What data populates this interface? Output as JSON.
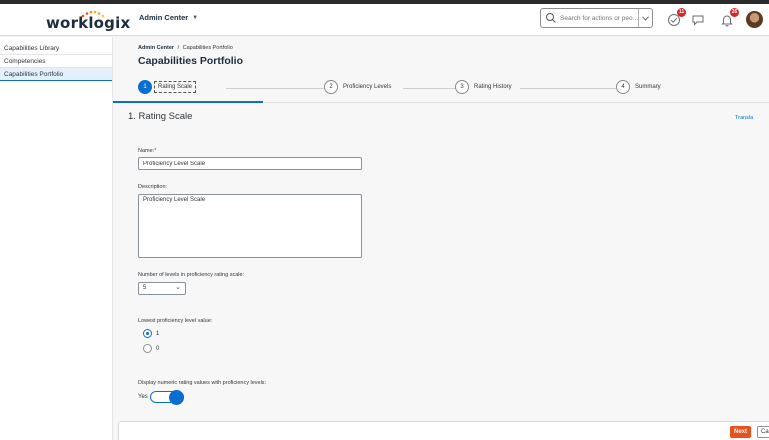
{
  "header": {
    "logo_text": "worklogix",
    "app_name": "Admin Center",
    "search_placeholder": "Search for actions or peo...",
    "badges": {
      "tasks": "11",
      "notifications": "26"
    }
  },
  "sidebar": {
    "items": [
      {
        "label": "Capabilities Library"
      },
      {
        "label": "Competencies"
      },
      {
        "label": "Capabilities Portfolio"
      }
    ]
  },
  "main": {
    "breadcrumb": {
      "root": "Admin Center",
      "separator": "/",
      "current": "Capabilities Portfolio"
    },
    "title": "Capabilities Portfolio",
    "wizard": {
      "steps": [
        {
          "num": "1",
          "label": "Rating Scale"
        },
        {
          "num": "2",
          "label": "Proficiency Levels"
        },
        {
          "num": "3",
          "label": "Rating History"
        },
        {
          "num": "4",
          "label": "Summary"
        }
      ]
    },
    "section_title": "1. Rating Scale",
    "translate_link": "Transla",
    "form": {
      "name_label": "Name:",
      "name_required": "*",
      "name_value": "Proficiency Level Scale",
      "description_label": "Description:",
      "description_value": "Proficiency Level Scale",
      "levels_label": "Number of levels in proficiency rating scale:",
      "levels_value": "5",
      "lowest_label": "Lowest proficiency level value:",
      "lowest_options": [
        "1",
        "0"
      ],
      "display_label": "Display numeric rating values with proficiency levels:",
      "display_toggle_text": "Yes"
    }
  },
  "footer": {
    "next_label": "Next",
    "cancel_label": "Cancel"
  },
  "colors": {
    "accent": "#0a6ed1",
    "next_button": "#e9501b",
    "badge": "#d9262b"
  }
}
